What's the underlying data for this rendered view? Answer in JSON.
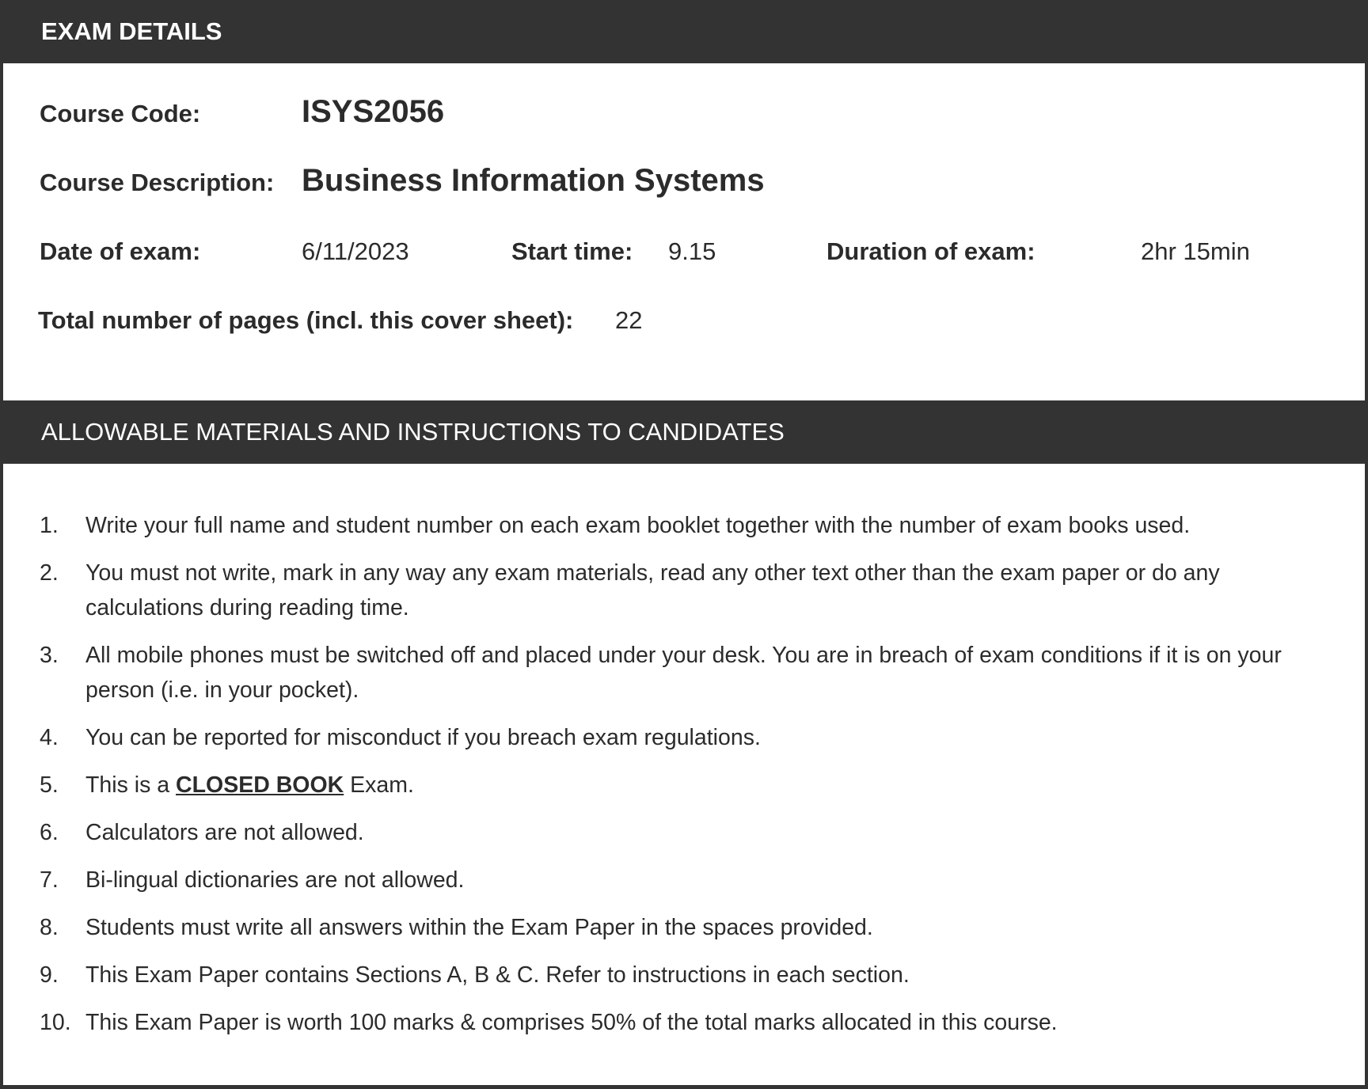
{
  "exam_details": {
    "heading": "EXAM DETAILS",
    "course_code_label": "Course Code:",
    "course_code": "ISYS2056",
    "course_description_label": "Course Description:",
    "course_description": "Business Information Systems",
    "date_label": "Date of exam:",
    "date": "6/11/2023",
    "start_time_label": "Start time:",
    "start_time": "9.15",
    "duration_label": "Duration of exam:",
    "duration": "2hr 15min",
    "pages_label": "Total number of pages (incl. this cover sheet):",
    "pages": "22"
  },
  "instructions": {
    "heading": "ALLOWABLE MATERIALS AND INSTRUCTIONS TO CANDIDATES",
    "items": [
      {
        "num": "1.",
        "text": "Write your full name and student number on each exam booklet together with the number of exam books used."
      },
      {
        "num": "2.",
        "text": "You must not write, mark in any way any exam materials, read any other text other than the exam paper or do any calculations during reading time."
      },
      {
        "num": "3.",
        "text": "All mobile phones must be switched off and placed under your desk. You are in breach of exam conditions if it is on your person (i.e. in your pocket)."
      },
      {
        "num": "4.",
        "text": "You can be reported for misconduct if you breach exam regulations."
      },
      {
        "num": "5.",
        "before": "This is a ",
        "emphasis": "CLOSED BOOK",
        "after": " Exam."
      },
      {
        "num": "6.",
        "text": "Calculators are not allowed."
      },
      {
        "num": "7.",
        "text": "Bi-lingual dictionaries are not allowed."
      },
      {
        "num": "8.",
        "text": "Students must write all answers within the Exam Paper in the spaces provided."
      },
      {
        "num": "9.",
        "text": "This Exam Paper contains Sections A, B & C. Refer to instructions in each section."
      },
      {
        "num": "10.",
        "text": "This Exam Paper is worth 100 marks & comprises 50% of the total marks allocated in this course."
      }
    ]
  }
}
